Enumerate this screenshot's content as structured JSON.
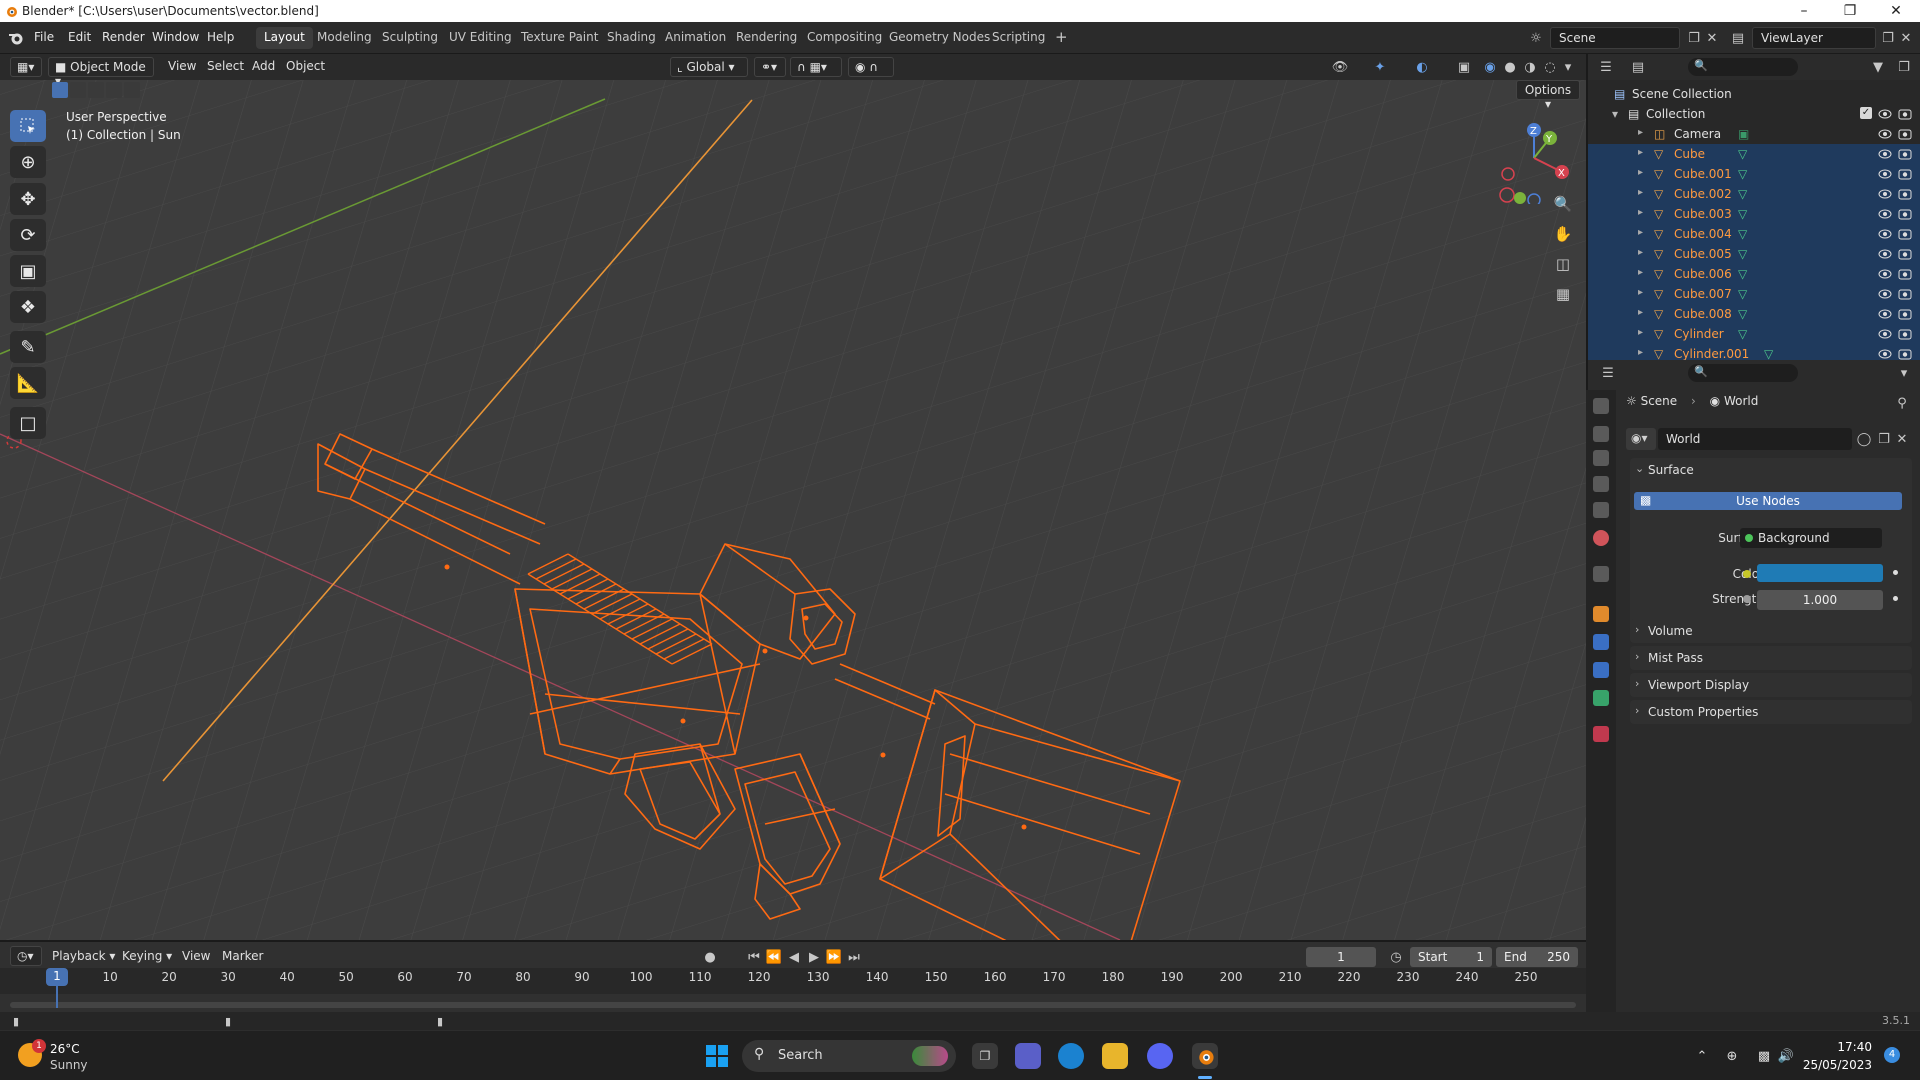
{
  "window": {
    "title": "Blender* [C:\\Users\\user\\Documents\\vector.blend]"
  },
  "menu": [
    "File",
    "Edit",
    "Render",
    "Window",
    "Help"
  ],
  "workspace_tabs": [
    "Layout",
    "Modeling",
    "Sculpting",
    "UV Editing",
    "Texture Paint",
    "Shading",
    "Animation",
    "Rendering",
    "Compositing",
    "Geometry Nodes",
    "Scripting"
  ],
  "active_workspace": "Layout",
  "scene_name": "Scene",
  "view_layer": "ViewLayer",
  "viewport": {
    "mode": "Object Mode",
    "menus": [
      "View",
      "Select",
      "Add",
      "Object"
    ],
    "orientation": "Global",
    "options_label": "Options",
    "overlay_line1": "User Perspective",
    "overlay_line2": "(1) Collection | Sun",
    "gizmo_axes": [
      "Z",
      "Y",
      "X"
    ],
    "tools": [
      "select-box",
      "cursor",
      "move",
      "rotate",
      "scale",
      "transform",
      "annotate",
      "measure",
      "add-cube"
    ]
  },
  "outliner": {
    "root": "Scene Collection",
    "collection": "Collection",
    "objects": [
      {
        "name": "Camera",
        "type": "camera",
        "selected": false
      },
      {
        "name": "Cube",
        "type": "mesh",
        "selected": true
      },
      {
        "name": "Cube.001",
        "type": "mesh",
        "selected": true
      },
      {
        "name": "Cube.002",
        "type": "mesh",
        "selected": true
      },
      {
        "name": "Cube.003",
        "type": "mesh",
        "selected": true
      },
      {
        "name": "Cube.004",
        "type": "mesh",
        "selected": true
      },
      {
        "name": "Cube.005",
        "type": "mesh",
        "selected": true
      },
      {
        "name": "Cube.006",
        "type": "mesh",
        "selected": true
      },
      {
        "name": "Cube.007",
        "type": "mesh",
        "selected": true
      },
      {
        "name": "Cube.008",
        "type": "mesh",
        "selected": true
      },
      {
        "name": "Cylinder",
        "type": "mesh",
        "selected": true
      },
      {
        "name": "Cylinder.001",
        "type": "mesh",
        "selected": true
      }
    ]
  },
  "properties": {
    "breadcrumb": [
      "Scene",
      "World"
    ],
    "world_name": "World",
    "surface_panel": "Surface",
    "use_nodes": "Use Nodes",
    "surface_label": "Surface",
    "surface_value": "Background",
    "color_label": "Color",
    "color_value": "#1f7bb5",
    "strength_label": "Strength",
    "strength_value": "1.000",
    "collapsed_panels": [
      "Volume",
      "Mist Pass",
      "Viewport Display",
      "Custom Properties"
    ]
  },
  "timeline": {
    "menus": [
      "Playback",
      "Keying",
      "View",
      "Marker"
    ],
    "current_frame": "1",
    "start_label": "Start",
    "start": "1",
    "end_label": "End",
    "end": "250",
    "ticks": [
      "1",
      "10",
      "20",
      "30",
      "40",
      "50",
      "60",
      "70",
      "80",
      "90",
      "100",
      "110",
      "120",
      "130",
      "140",
      "150",
      "160",
      "170",
      "180",
      "190",
      "200",
      "210",
      "220",
      "230",
      "240",
      "250"
    ]
  },
  "version": "3.5.1",
  "taskbar": {
    "weather_temp": "26°C",
    "weather_desc": "Sunny",
    "weather_badge": "1",
    "search_label": "Search",
    "time": "17:40",
    "date": "25/05/2023",
    "notif_count": "4"
  },
  "colors": {
    "accent": "#4772b3",
    "selection": "#ff6a13",
    "axis_x": "#c54b5c",
    "axis_y": "#6a9a34",
    "world_color": "#1f7bb5"
  }
}
